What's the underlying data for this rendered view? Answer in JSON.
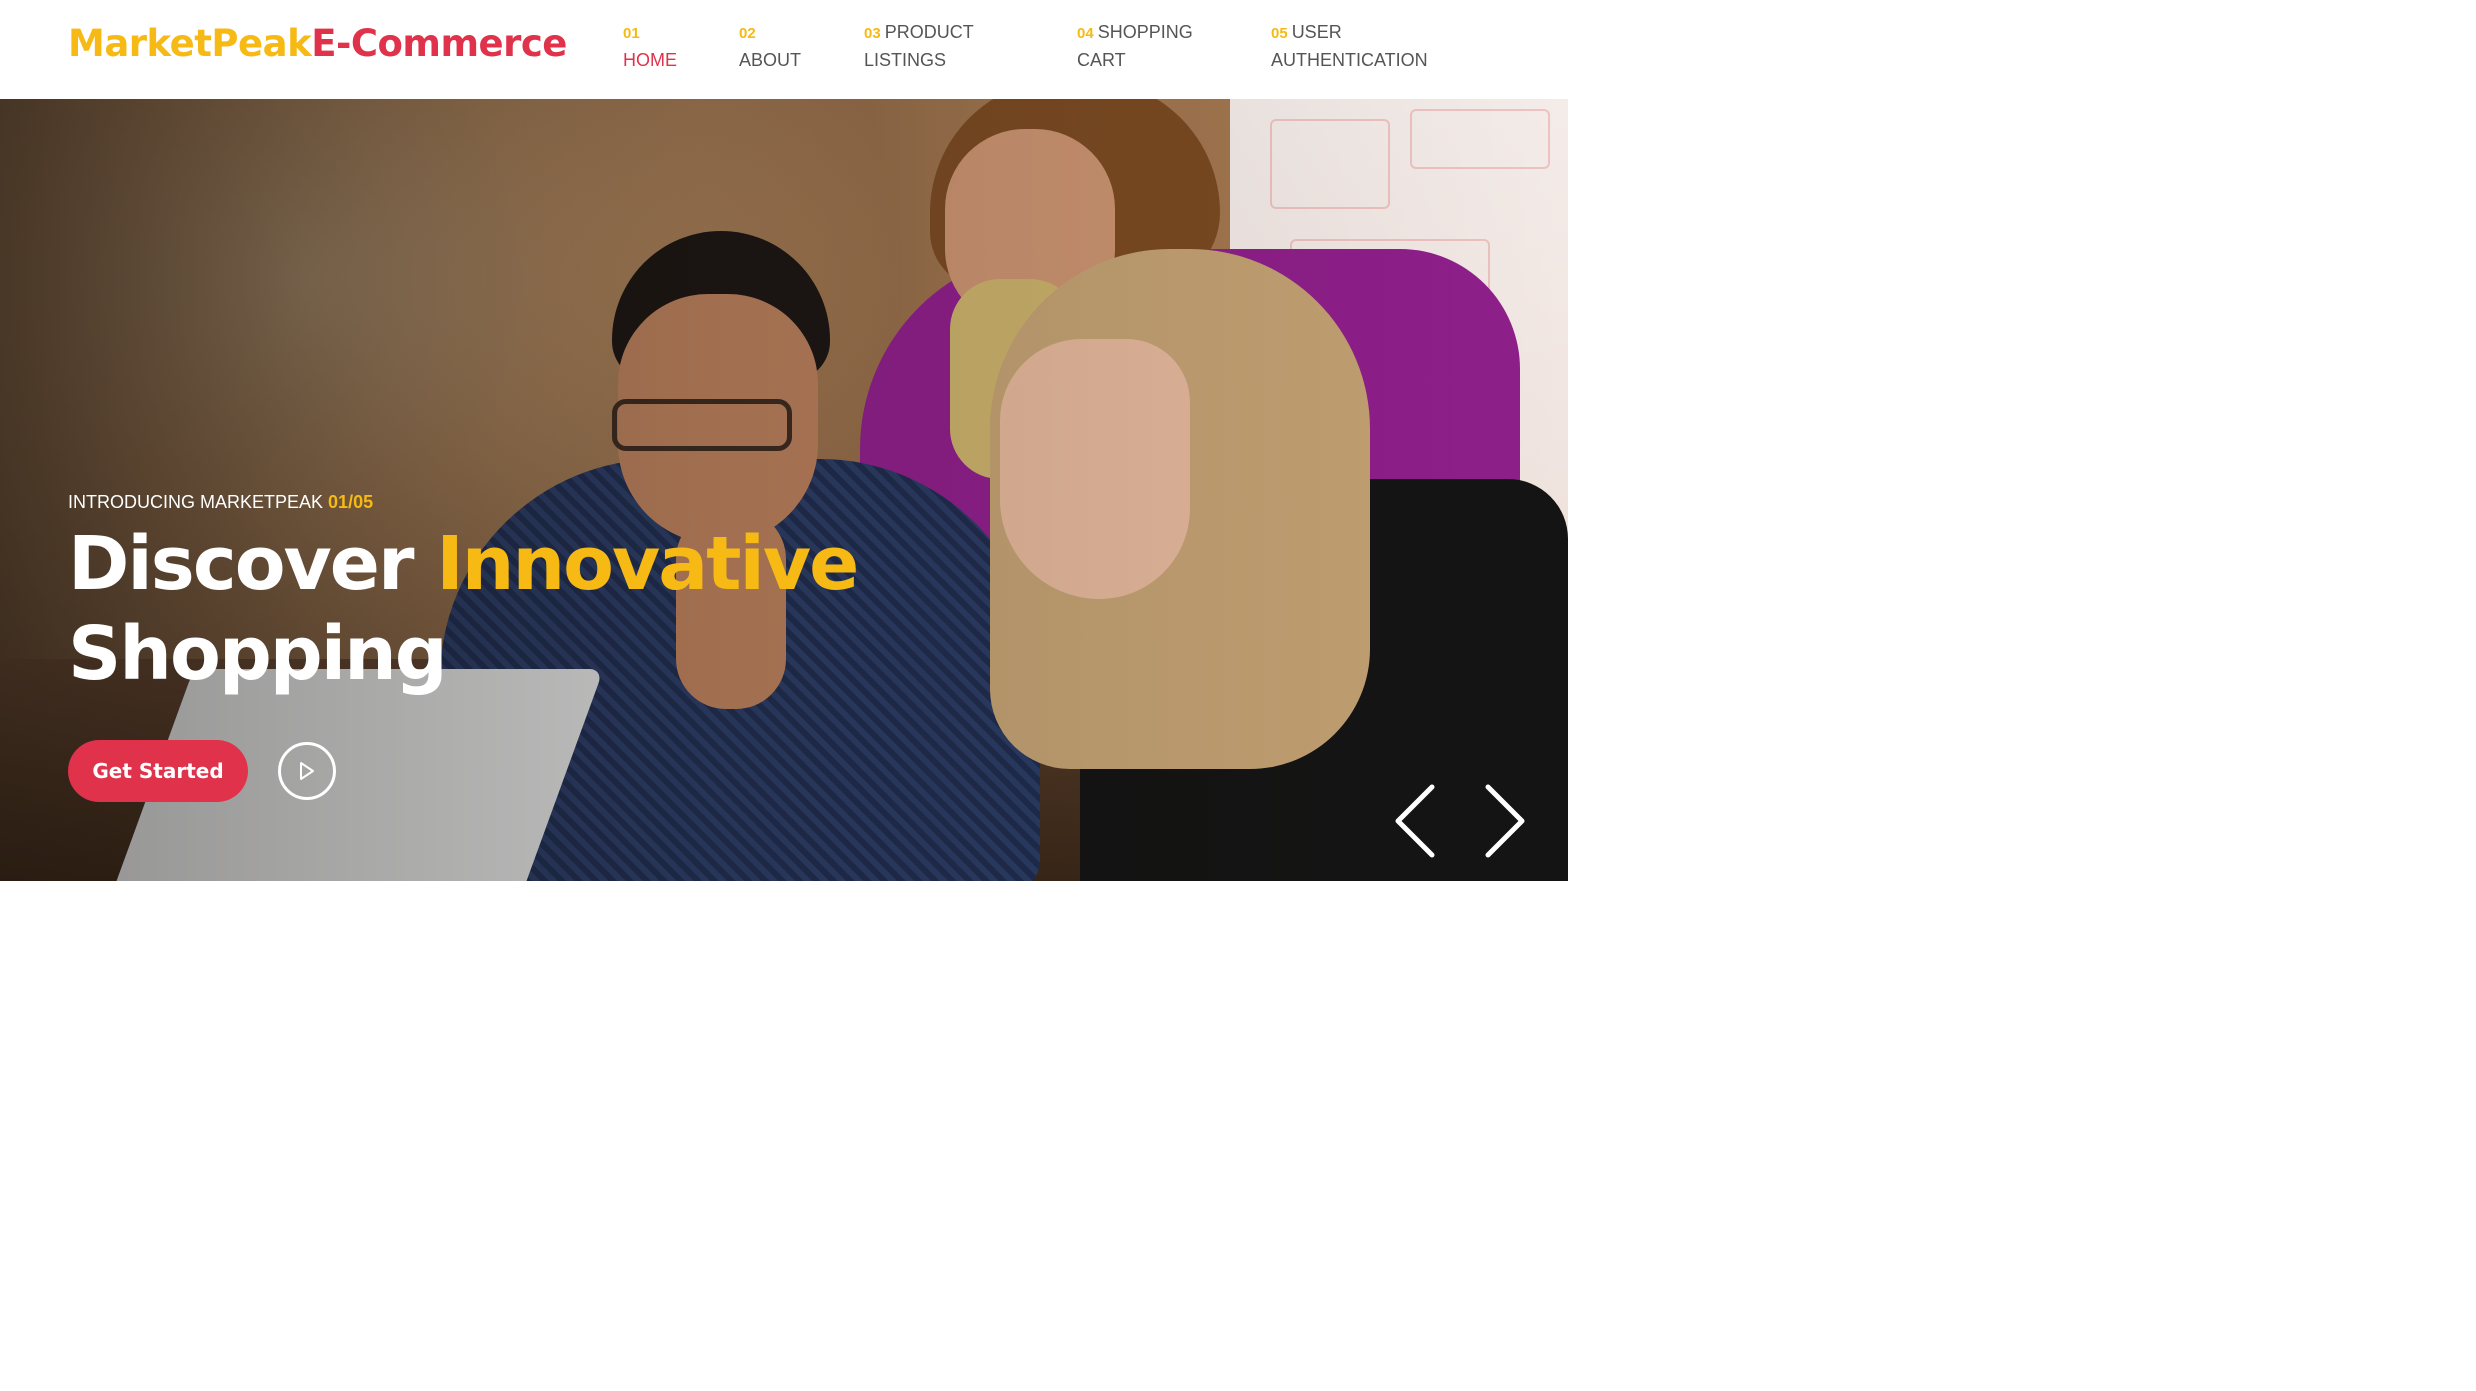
{
  "brand": {
    "part1": "MarketPeak",
    "part2": "E-Commerce"
  },
  "nav": [
    {
      "num": "01",
      "label": "HOME",
      "active": true
    },
    {
      "num": "02",
      "label": "ABOUT"
    },
    {
      "num": "03",
      "label_line1": "PRODUCT",
      "label_line2": "LISTINGS"
    },
    {
      "num": "04",
      "label_line1": "SHOPPING",
      "label_line2": "CART"
    },
    {
      "num": "05",
      "label_line1": "USER",
      "label_line2": "AUTHENTICATION"
    }
  ],
  "hero": {
    "intro": "INTRODUCING MARKETPEAK",
    "slide_counter": "01/05",
    "title_part1": "Discover ",
    "title_highlight": "Innovative",
    "title_line2": "Shopping",
    "cta_label": "Get Started",
    "play_icon": "play-icon",
    "prev_icon": "chevron-left-icon",
    "next_icon": "chevron-right-icon"
  },
  "colors": {
    "accent_yellow": "#f7b913",
    "accent_red": "#e0324b",
    "nav_text": "#555555"
  }
}
